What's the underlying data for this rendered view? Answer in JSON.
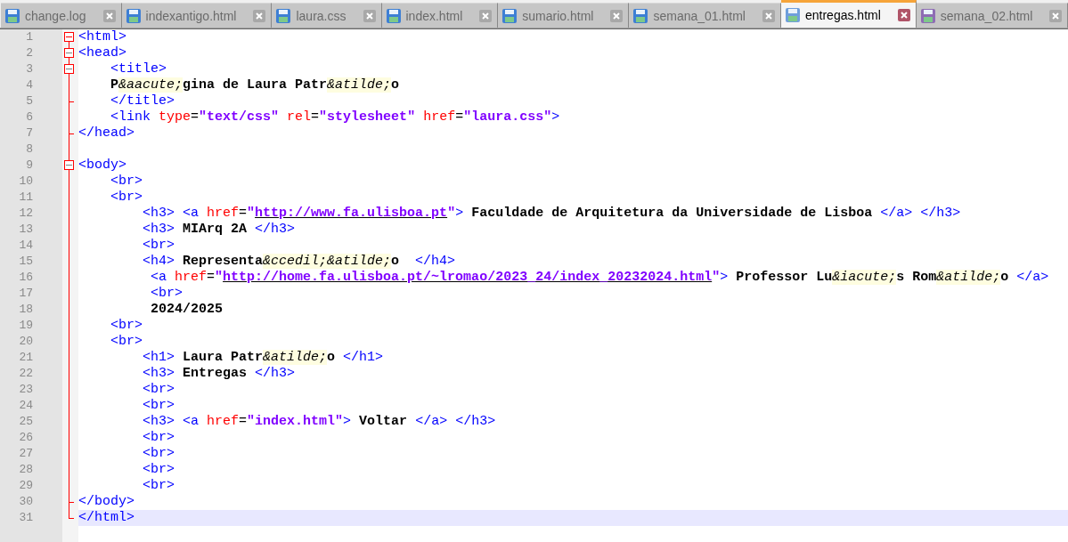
{
  "tabs": [
    {
      "label": "change.log",
      "selected": false,
      "color": "#3d7fd4"
    },
    {
      "label": "indexantigo.html",
      "selected": false,
      "color": "#3d7fd4"
    },
    {
      "label": "laura.css",
      "selected": false,
      "color": "#3d7fd4"
    },
    {
      "label": "index.html",
      "selected": false,
      "color": "#3d7fd4"
    },
    {
      "label": "sumario.html",
      "selected": false,
      "color": "#3d7fd4"
    },
    {
      "label": "semana_01.html",
      "selected": false,
      "color": "#3d7fd4"
    },
    {
      "label": "entregas.html",
      "selected": true,
      "color": "#6f9fdc"
    },
    {
      "label": "semana_02.html",
      "selected": false,
      "color": "#8e6cb4"
    }
  ],
  "editor": {
    "lines": [
      {
        "number": "1",
        "fold_start": true,
        "fold_end": false,
        "current": false,
        "tokens": [
          {
            "kind": "tag",
            "text": "<html>"
          }
        ]
      },
      {
        "number": "2",
        "fold_start": true,
        "fold_end": false,
        "current": false,
        "tokens": [
          {
            "kind": "tag",
            "text": "<head>"
          }
        ]
      },
      {
        "number": "3",
        "fold_start": true,
        "fold_end": false,
        "current": false,
        "tokens": [
          {
            "kind": "tag",
            "text": "    <title>"
          }
        ]
      },
      {
        "number": "4",
        "fold_start": false,
        "fold_end": false,
        "current": false,
        "tokens": [
          {
            "kind": "text",
            "text": "    P"
          },
          {
            "kind": "entity",
            "text": "&aacute;"
          },
          {
            "kind": "text",
            "text": "gina de Laura Patr"
          },
          {
            "kind": "entity",
            "text": "&atilde;"
          },
          {
            "kind": "text",
            "text": "o"
          }
        ]
      },
      {
        "number": "5",
        "fold_start": false,
        "fold_end": true,
        "current": false,
        "tokens": [
          {
            "kind": "tag",
            "text": "    </title>"
          }
        ]
      },
      {
        "number": "6",
        "fold_start": false,
        "fold_end": false,
        "current": false,
        "tokens": [
          {
            "kind": "tag",
            "text": "    <link "
          },
          {
            "kind": "attr",
            "text": "type"
          },
          {
            "kind": "op",
            "text": "="
          },
          {
            "kind": "string",
            "text": "\"text/css\" "
          },
          {
            "kind": "attr",
            "text": "rel"
          },
          {
            "kind": "op",
            "text": "="
          },
          {
            "kind": "string",
            "text": "\"stylesheet\" "
          },
          {
            "kind": "attr",
            "text": "href"
          },
          {
            "kind": "op",
            "text": "="
          },
          {
            "kind": "string",
            "text": "\"laura.css\""
          },
          {
            "kind": "tag",
            "text": ">"
          }
        ]
      },
      {
        "number": "7",
        "fold_start": false,
        "fold_end": true,
        "current": false,
        "tokens": [
          {
            "kind": "tag",
            "text": "</head>"
          }
        ]
      },
      {
        "number": "8",
        "fold_start": false,
        "fold_end": false,
        "current": false
      },
      {
        "number": "9",
        "fold_start": true,
        "fold_end": false,
        "current": false,
        "tokens": [
          {
            "kind": "tag",
            "text": "<body>"
          }
        ]
      },
      {
        "number": "10",
        "fold_start": false,
        "fold_end": false,
        "current": false,
        "tokens": [
          {
            "kind": "tag",
            "text": "    <br>"
          }
        ]
      },
      {
        "number": "11",
        "fold_start": false,
        "fold_end": false,
        "current": false,
        "tokens": [
          {
            "kind": "tag",
            "text": "    <br>"
          }
        ]
      },
      {
        "number": "12",
        "fold_start": false,
        "fold_end": false,
        "current": false,
        "tokens": [
          {
            "kind": "tag",
            "text": "        <h3> <a "
          },
          {
            "kind": "attr",
            "text": "href"
          },
          {
            "kind": "op",
            "text": "="
          },
          {
            "kind": "string",
            "text": "\""
          },
          {
            "kind": "link",
            "text": "http://www.fa.ulisboa.pt"
          },
          {
            "kind": "string",
            "text": "\""
          },
          {
            "kind": "tag",
            "text": "> "
          },
          {
            "kind": "text",
            "text": "Faculdade de Arquitetura da Universidade de Lisboa "
          },
          {
            "kind": "tag",
            "text": "</a> </h3>"
          }
        ]
      },
      {
        "number": "13",
        "fold_start": false,
        "fold_end": false,
        "current": false,
        "tokens": [
          {
            "kind": "tag",
            "text": "        <h3> "
          },
          {
            "kind": "text",
            "text": "MIArq 2A "
          },
          {
            "kind": "tag",
            "text": "</h3>"
          }
        ]
      },
      {
        "number": "14",
        "fold_start": false,
        "fold_end": false,
        "current": false,
        "tokens": [
          {
            "kind": "tag",
            "text": "        <br>"
          }
        ]
      },
      {
        "number": "15",
        "fold_start": false,
        "fold_end": false,
        "current": false,
        "tokens": [
          {
            "kind": "tag",
            "text": "        <h4> "
          },
          {
            "kind": "text",
            "text": "Representa"
          },
          {
            "kind": "entity",
            "text": "&ccedil;"
          },
          {
            "kind": "entity",
            "text": "&atilde;"
          },
          {
            "kind": "text",
            "text": "o  "
          },
          {
            "kind": "tag",
            "text": "</h4>"
          }
        ]
      },
      {
        "number": "16",
        "fold_start": false,
        "fold_end": false,
        "current": false,
        "tokens": [
          {
            "kind": "tag",
            "text": "         <a "
          },
          {
            "kind": "attr",
            "text": "href"
          },
          {
            "kind": "op",
            "text": "="
          },
          {
            "kind": "string",
            "text": "\""
          },
          {
            "kind": "link",
            "text": "http://home.fa.ulisboa.pt/~lromao/2023_24/index_20232024.html"
          },
          {
            "kind": "string",
            "text": "\""
          },
          {
            "kind": "tag",
            "text": "> "
          },
          {
            "kind": "text",
            "text": "Professor Lu"
          },
          {
            "kind": "entity",
            "text": "&iacute;"
          },
          {
            "kind": "text",
            "text": "s Rom"
          },
          {
            "kind": "entity",
            "text": "&atilde;"
          },
          {
            "kind": "text",
            "text": "o "
          },
          {
            "kind": "tag",
            "text": "</a>"
          }
        ]
      },
      {
        "number": "17",
        "fold_start": false,
        "fold_end": false,
        "current": false,
        "tokens": [
          {
            "kind": "tag",
            "text": "         <br>"
          }
        ]
      },
      {
        "number": "18",
        "fold_start": false,
        "fold_end": false,
        "current": false,
        "tokens": [
          {
            "kind": "text",
            "text": "         2024/2025"
          }
        ]
      },
      {
        "number": "19",
        "fold_start": false,
        "fold_end": false,
        "current": false,
        "tokens": [
          {
            "kind": "tag",
            "text": "    <br>"
          }
        ]
      },
      {
        "number": "20",
        "fold_start": false,
        "fold_end": false,
        "current": false,
        "tokens": [
          {
            "kind": "tag",
            "text": "    <br>"
          }
        ]
      },
      {
        "number": "21",
        "fold_start": false,
        "fold_end": false,
        "current": false,
        "tokens": [
          {
            "kind": "tag",
            "text": "        <h1> "
          },
          {
            "kind": "text",
            "text": "Laura Patr"
          },
          {
            "kind": "entity",
            "text": "&atilde;"
          },
          {
            "kind": "text",
            "text": "o "
          },
          {
            "kind": "tag",
            "text": "</h1>"
          }
        ]
      },
      {
        "number": "22",
        "fold_start": false,
        "fold_end": false,
        "current": false,
        "tokens": [
          {
            "kind": "tag",
            "text": "        <h3> "
          },
          {
            "kind": "text",
            "text": "Entregas "
          },
          {
            "kind": "tag",
            "text": "</h3>"
          }
        ]
      },
      {
        "number": "23",
        "fold_start": false,
        "fold_end": false,
        "current": false,
        "tokens": [
          {
            "kind": "tag",
            "text": "        <br>"
          }
        ]
      },
      {
        "number": "24",
        "fold_start": false,
        "fold_end": false,
        "current": false,
        "tokens": [
          {
            "kind": "tag",
            "text": "        <br>"
          }
        ]
      },
      {
        "number": "25",
        "fold_start": false,
        "fold_end": false,
        "current": false,
        "tokens": [
          {
            "kind": "tag",
            "text": "        <h3> <a "
          },
          {
            "kind": "attr",
            "text": "href"
          },
          {
            "kind": "op",
            "text": "="
          },
          {
            "kind": "string",
            "text": "\"index.html\""
          },
          {
            "kind": "tag",
            "text": "> "
          },
          {
            "kind": "text",
            "text": "Voltar "
          },
          {
            "kind": "tag",
            "text": "</a> </h3>"
          }
        ]
      },
      {
        "number": "26",
        "fold_start": false,
        "fold_end": false,
        "current": false,
        "tokens": [
          {
            "kind": "tag",
            "text": "        <br>"
          }
        ]
      },
      {
        "number": "27",
        "fold_start": false,
        "fold_end": false,
        "current": false,
        "tokens": [
          {
            "kind": "tag",
            "text": "        <br>"
          }
        ]
      },
      {
        "number": "28",
        "fold_start": false,
        "fold_end": false,
        "current": false,
        "tokens": [
          {
            "kind": "tag",
            "text": "        <br>"
          }
        ]
      },
      {
        "number": "29",
        "fold_start": false,
        "fold_end": false,
        "current": false,
        "tokens": [
          {
            "kind": "tag",
            "text": "        <br>"
          }
        ]
      },
      {
        "number": "30",
        "fold_start": false,
        "fold_end": true,
        "current": false,
        "tokens": [
          {
            "kind": "tag",
            "text": "</body>"
          }
        ]
      },
      {
        "number": "31",
        "fold_start": false,
        "fold_end": true,
        "current": true,
        "tokens": [
          {
            "kind": "tag",
            "text": "</html>"
          }
        ]
      }
    ]
  }
}
